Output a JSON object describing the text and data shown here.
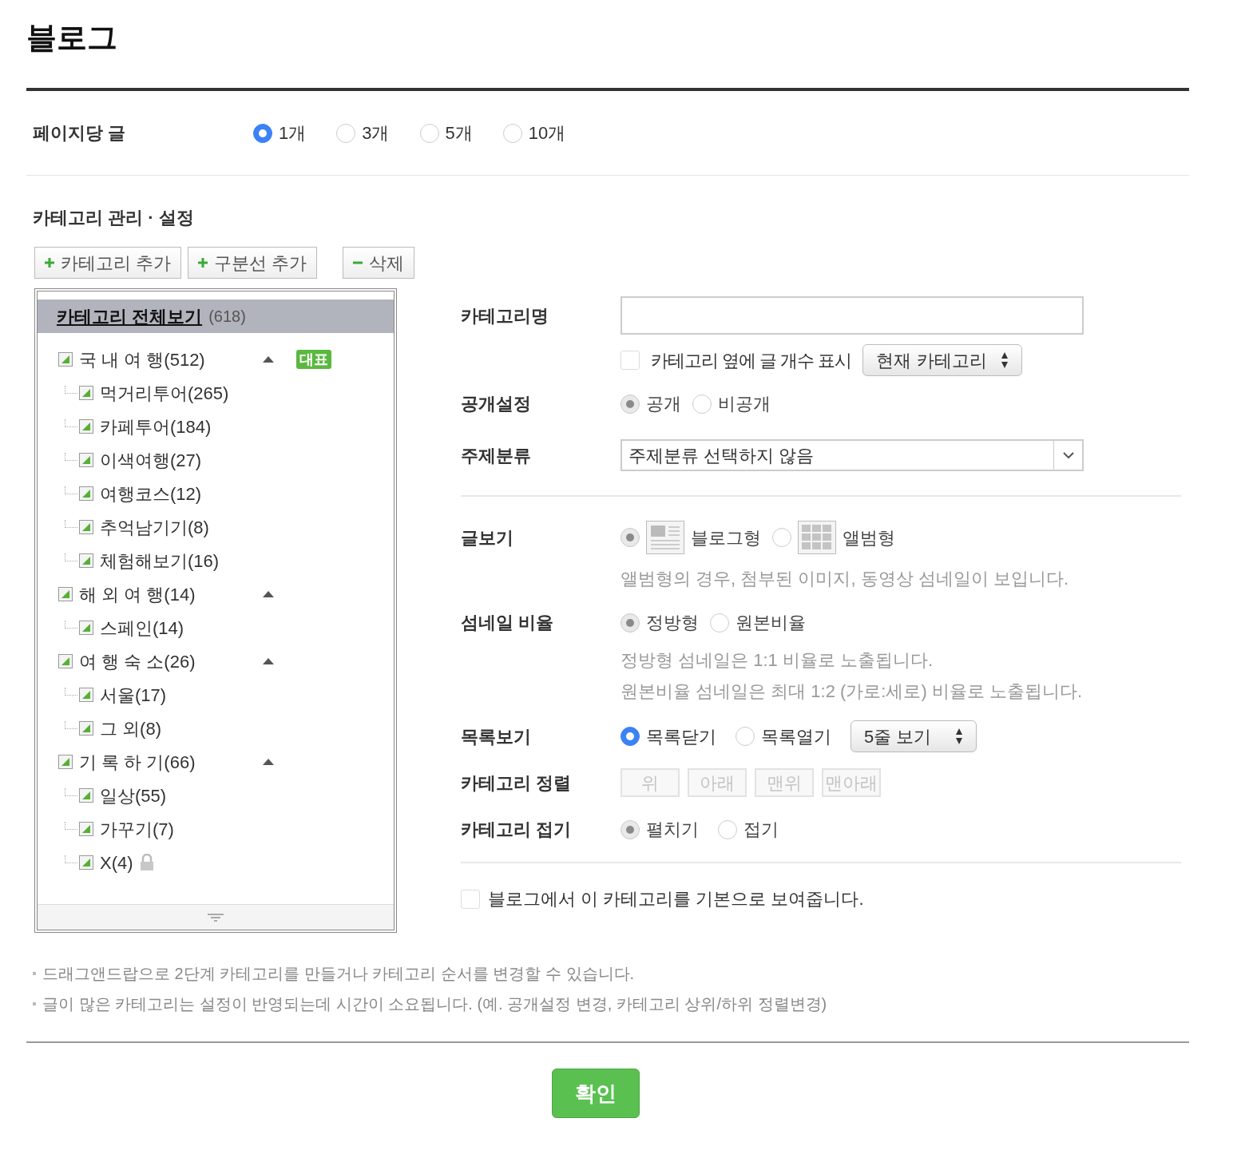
{
  "title": "블로그",
  "posts_per_page": {
    "label": "페이지당 글",
    "disabled": false,
    "options": [
      {
        "label": "1개",
        "selected": true
      },
      {
        "label": "3개",
        "selected": false
      },
      {
        "label": "5개",
        "selected": false
      },
      {
        "label": "10개",
        "selected": false
      }
    ]
  },
  "category_section": {
    "title": "카테고리 관리 · 설정",
    "toolbar": [
      {
        "kind": "plus",
        "label": "카테고리 추가"
      },
      {
        "kind": "plus",
        "label": "구분선 추가"
      },
      {
        "kind": "minus",
        "label": "삭제"
      }
    ],
    "tree": {
      "all": {
        "label": "카테고리 전체보기",
        "count": "(618)",
        "selected": true
      },
      "items": [
        {
          "label": "국 내 여 행(512)",
          "expanded": true,
          "badge": "대표",
          "children": [
            {
              "label": "먹거리투어(265)",
              "locked": false
            },
            {
              "label": "카페투어(184)",
              "locked": false
            },
            {
              "label": "이색여행(27)",
              "locked": false
            },
            {
              "label": "여행코스(12)",
              "locked": false
            },
            {
              "label": "추억남기기(8)",
              "locked": false
            },
            {
              "label": "체험해보기(16)",
              "locked": false
            }
          ]
        },
        {
          "label": "해 외 여 행(14)",
          "expanded": true,
          "children": [
            {
              "label": "스페인(14)",
              "locked": false
            }
          ]
        },
        {
          "label": "여 행 숙 소(26)",
          "expanded": true,
          "children": [
            {
              "label": "서울(17)",
              "locked": false
            },
            {
              "label": "그 외(8)",
              "locked": false
            }
          ]
        },
        {
          "label": "기 록 하 기(66)",
          "expanded": true,
          "children": [
            {
              "label": "일상(55)",
              "locked": false
            },
            {
              "label": "가꾸기(7)",
              "locked": false
            },
            {
              "label": "X(4)",
              "locked": true
            }
          ]
        }
      ]
    }
  },
  "form": {
    "name": {
      "label": "카테고리명"
    },
    "count_display": {
      "label": "카테고리 옆에 글 개수 표시",
      "checked": false,
      "select": "현재 카테고리"
    },
    "visibility": {
      "label": "공개설정",
      "disabled": true,
      "options": [
        {
          "label": "공개",
          "selected": true
        },
        {
          "label": "비공개",
          "selected": false
        }
      ]
    },
    "topic": {
      "label": "주제분류",
      "value": "주제분류 선택하지 않음"
    },
    "view": {
      "label": "글보기",
      "disabled": true,
      "options": [
        {
          "label": "블로그형",
          "kind": "blog",
          "selected": true
        },
        {
          "label": "앨범형",
          "kind": "album",
          "selected": false
        }
      ],
      "note": "앨범형의 경우, 첨부된 이미지, 동영상 섬네일이 보입니다."
    },
    "thumbnail": {
      "label": "섬네일 비율",
      "disabled": true,
      "options": [
        {
          "label": "정방형",
          "selected": true
        },
        {
          "label": "원본비율",
          "selected": false
        }
      ],
      "notes": [
        "정방형 섬네일은 1:1 비율로 노출됩니다.",
        "원본비율 섬네일은 최대 1:2 (가로:세로) 비율로 노출됩니다."
      ]
    },
    "list_view": {
      "label": "목록보기",
      "disabled": false,
      "options": [
        {
          "label": "목록닫기",
          "selected": true
        },
        {
          "label": "목록열기",
          "selected": false
        }
      ],
      "select": "5줄 보기"
    },
    "sort": {
      "label": "카테고리 정렬",
      "buttons": [
        {
          "label": "위",
          "disabled": true
        },
        {
          "label": "아래",
          "disabled": true
        },
        {
          "label": "맨위",
          "disabled": true
        },
        {
          "label": "맨아래",
          "disabled": true
        }
      ]
    },
    "fold": {
      "label": "카테고리 접기",
      "disabled": true,
      "options": [
        {
          "label": "펼치기",
          "selected": true
        },
        {
          "label": "접기",
          "selected": false
        }
      ]
    },
    "default": {
      "label": "블로그에서 이 카테고리를 기본으로 보여줍니다.",
      "checked": false
    }
  },
  "notes": [
    "드래그앤드랍으로 2단계 카테고리를 만들거나 카테고리 순서를 변경할 수 있습니다.",
    "글이 많은 카테고리는 설정이 반영되는데 시간이 소요됩니다. (예. 공개설정 변경, 카테고리 상위/하위 정렬변경)"
  ],
  "confirm": "확인"
}
